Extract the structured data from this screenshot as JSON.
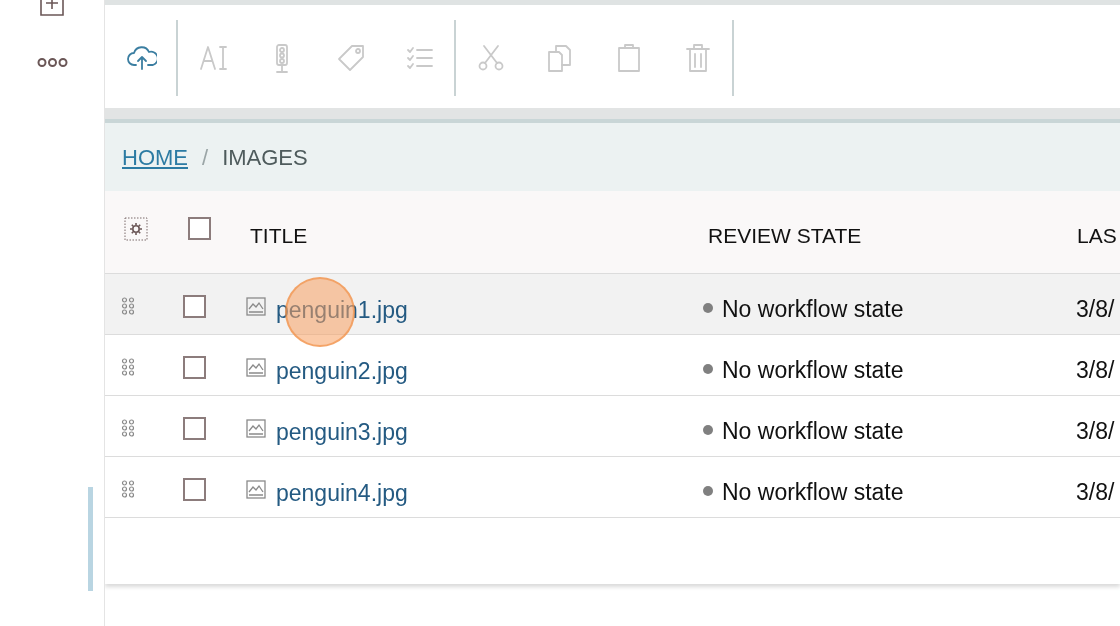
{
  "toolbar": [
    {
      "kind": "upload",
      "disabled": false
    },
    {
      "kind": "divider"
    },
    {
      "kind": "rename",
      "disabled": true
    },
    {
      "kind": "state",
      "disabled": true
    },
    {
      "kind": "tags",
      "disabled": true
    },
    {
      "kind": "properties",
      "disabled": true
    },
    {
      "kind": "divider"
    },
    {
      "kind": "cut",
      "disabled": true
    },
    {
      "kind": "copy",
      "disabled": true
    },
    {
      "kind": "paste",
      "disabled": true
    },
    {
      "kind": "delete",
      "disabled": true
    },
    {
      "kind": "divider"
    }
  ],
  "breadcrumbs": [
    {
      "label": "HOME",
      "kind": "link"
    },
    {
      "label": "/",
      "kind": "separator"
    },
    {
      "label": "IMAGES",
      "kind": "current"
    }
  ],
  "table": {
    "columns": [
      "TITLE",
      "REVIEW STATE",
      "LAS"
    ],
    "rows": [
      {
        "title": "penguin1.jpg",
        "review_state": "No workflow state",
        "date": "3/8/",
        "checked": false,
        "highlighted": true
      },
      {
        "title": "penguin2.jpg",
        "review_state": "No workflow state",
        "date": "3/8/",
        "checked": false,
        "highlighted": false
      },
      {
        "title": "penguin3.jpg",
        "review_state": "No workflow state",
        "date": "3/8/",
        "checked": false,
        "highlighted": false
      },
      {
        "title": "penguin4.jpg",
        "review_state": "No workflow state",
        "date": "3/8/",
        "checked": false,
        "highlighted": false
      }
    ]
  },
  "select_all": {
    "checked": false
  }
}
